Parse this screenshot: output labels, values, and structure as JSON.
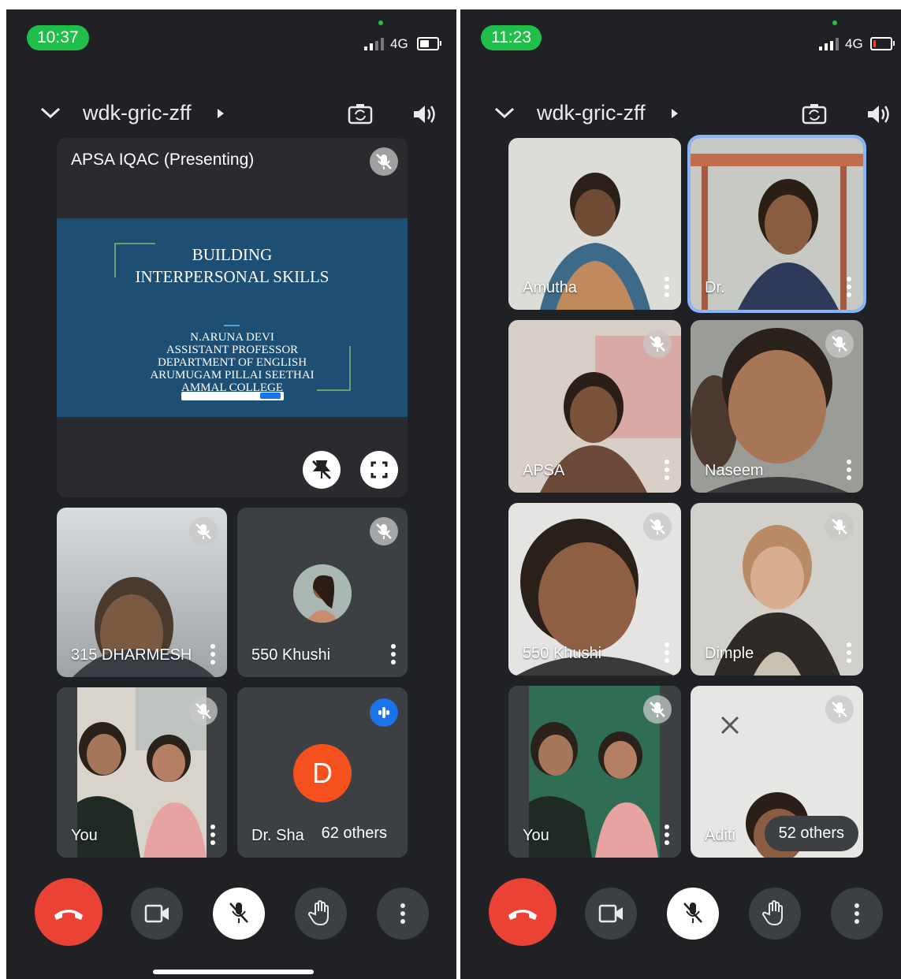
{
  "left": {
    "status": {
      "time": "10:37",
      "network": "4G"
    },
    "meeting_code": "wdk-gric-zff",
    "presenter": {
      "title": "APSA IQAC (Presenting)",
      "slide": {
        "heading_line1": "BUILDING",
        "heading_line2": "INTERPERSONAL SKILLS",
        "sub_line1": "N.ARUNA DEVI",
        "sub_line2": "ASSISTANT PROFESSOR",
        "sub_line3": "DEPARTMENT OF ENGLISH",
        "sub_line4": "ARUMUGAM PILLAI SEETHAI",
        "sub_line5": "AMMAL COLLEGE"
      }
    },
    "tiles": [
      {
        "name": "315 DHARMESH"
      },
      {
        "name": "550 Khushi"
      },
      {
        "name": "You"
      },
      {
        "name": "Dr. Sha",
        "avatar_letter": "D",
        "others": "62 others"
      }
    ]
  },
  "right": {
    "status": {
      "time": "11:23",
      "network": "4G"
    },
    "meeting_code": "wdk-gric-zff",
    "tiles": [
      {
        "name": "Amutha"
      },
      {
        "name": "Dr."
      },
      {
        "name": "APSA"
      },
      {
        "name": "Naseem"
      },
      {
        "name": "550 Khushi"
      },
      {
        "name": "Dimple"
      },
      {
        "name": "You"
      },
      {
        "name": "Aditi",
        "others": "52 others"
      }
    ]
  },
  "colors": {
    "background": "#202124",
    "tile": "#3c4043",
    "end_call": "#ea4335",
    "status_green": "#1fbf4a",
    "active_outline": "#8ab4f8",
    "avatar_orange": "#f4511e"
  }
}
